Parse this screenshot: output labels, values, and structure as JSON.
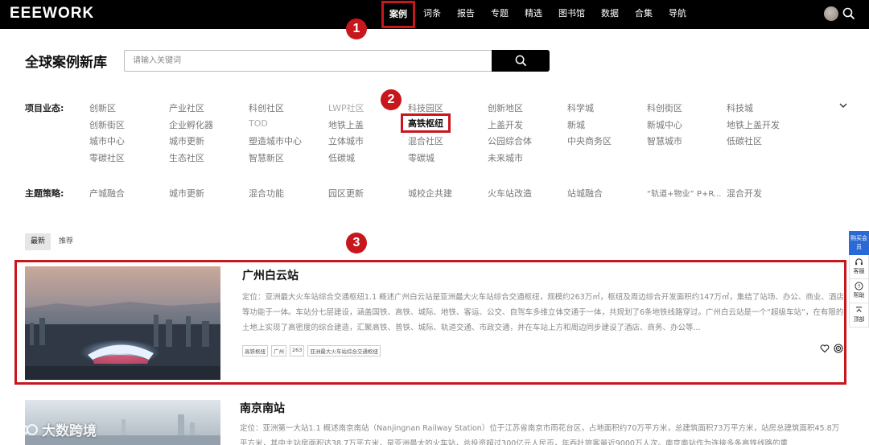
{
  "header": {
    "logo": "EEEWORK",
    "nav": [
      "案例",
      "词条",
      "报告",
      "专题",
      "精选",
      "图书馆",
      "数据",
      "合集",
      "导航"
    ]
  },
  "annotations": [
    "1",
    "2",
    "3"
  ],
  "search": {
    "title": "全球案例新库",
    "placeholder": "请输入关键词"
  },
  "filters": {
    "business_label": "项目业态:",
    "business_rows": [
      [
        "创新区",
        "产业社区",
        "科创社区",
        "LWP社区",
        "科技园区",
        "创新地区",
        "科学城",
        "科创街区",
        "科技城"
      ],
      [
        "创新街区",
        "企业孵化器",
        "TOD",
        "地铁上盖",
        "高铁枢纽",
        "上盖开发",
        "新城",
        "新城中心",
        "地铁上盖开发"
      ],
      [
        "城市中心",
        "城市更新",
        "塑造城市中心",
        "立体城市",
        "混合社区",
        "公园综合体",
        "中央商务区",
        "智慧城市",
        "低碳社区"
      ],
      [
        "零碳社区",
        "生态社区",
        "智慧新区",
        "低碳城",
        "零碳城",
        "未来城市"
      ]
    ],
    "strategy_label": "主题策略:",
    "strategies": [
      "产城融合",
      "城市更新",
      "混合功能",
      "园区更新",
      "城校企共建",
      "火车站改造",
      "站城融合",
      "“轨道+物业” P+R...",
      "混合开发"
    ]
  },
  "sort_tabs": [
    "最新",
    "推荐"
  ],
  "cards": [
    {
      "title": "广州白云站",
      "desc": "定位：亚洲最大火车站综合交通枢纽1.1 概述广州白云站是亚洲最大火车站综合交通枢纽，规模约263万㎡，枢纽及周边综合开发面积约147万㎡，集结了站场、办公、商业、酒店等功能于一体。车站分七层建设，涵盖国铁、高铁、城际、地铁、客运、公交、自驾车多维立体交通于一体，共规划了6条地铁线路穿过。广州白云站是一个“超级车站”，在有限的土地上实现了高密度的综合建造，汇聚高铁、普铁、城际、轨道交通、市政交通，并在车站上方和周边同步建设了酒店、商务、办公等...",
      "tags": [
        "高铁枢纽",
        "广州",
        "263",
        "亚洲最大火车站综合交通枢纽"
      ]
    },
    {
      "title": "南京南站",
      "desc": "定位：亚洲第一大站1.1 概述南京南站（Nanjingnan Railway Station）位于江苏省南京市雨花台区，占地面积约70万平方米，总建筑面积73万平方米，站房总建筑面积45.8万平方米，其中主站房面积达38.7万平方米，是亚洲最大的火车站，总投资超过300亿元人民币，年吞吐旅客量近9000万人次。南京南站作为连接多条高铁线路的重"
    }
  ],
  "float_bar": {
    "member": "购买会员",
    "items": [
      "客服",
      "帮助",
      "顶部"
    ]
  },
  "watermark": "大数跨境",
  "colors": {
    "topbar": "#000000",
    "highlight": "#c8161d",
    "member_button": "#2a6ad6"
  }
}
